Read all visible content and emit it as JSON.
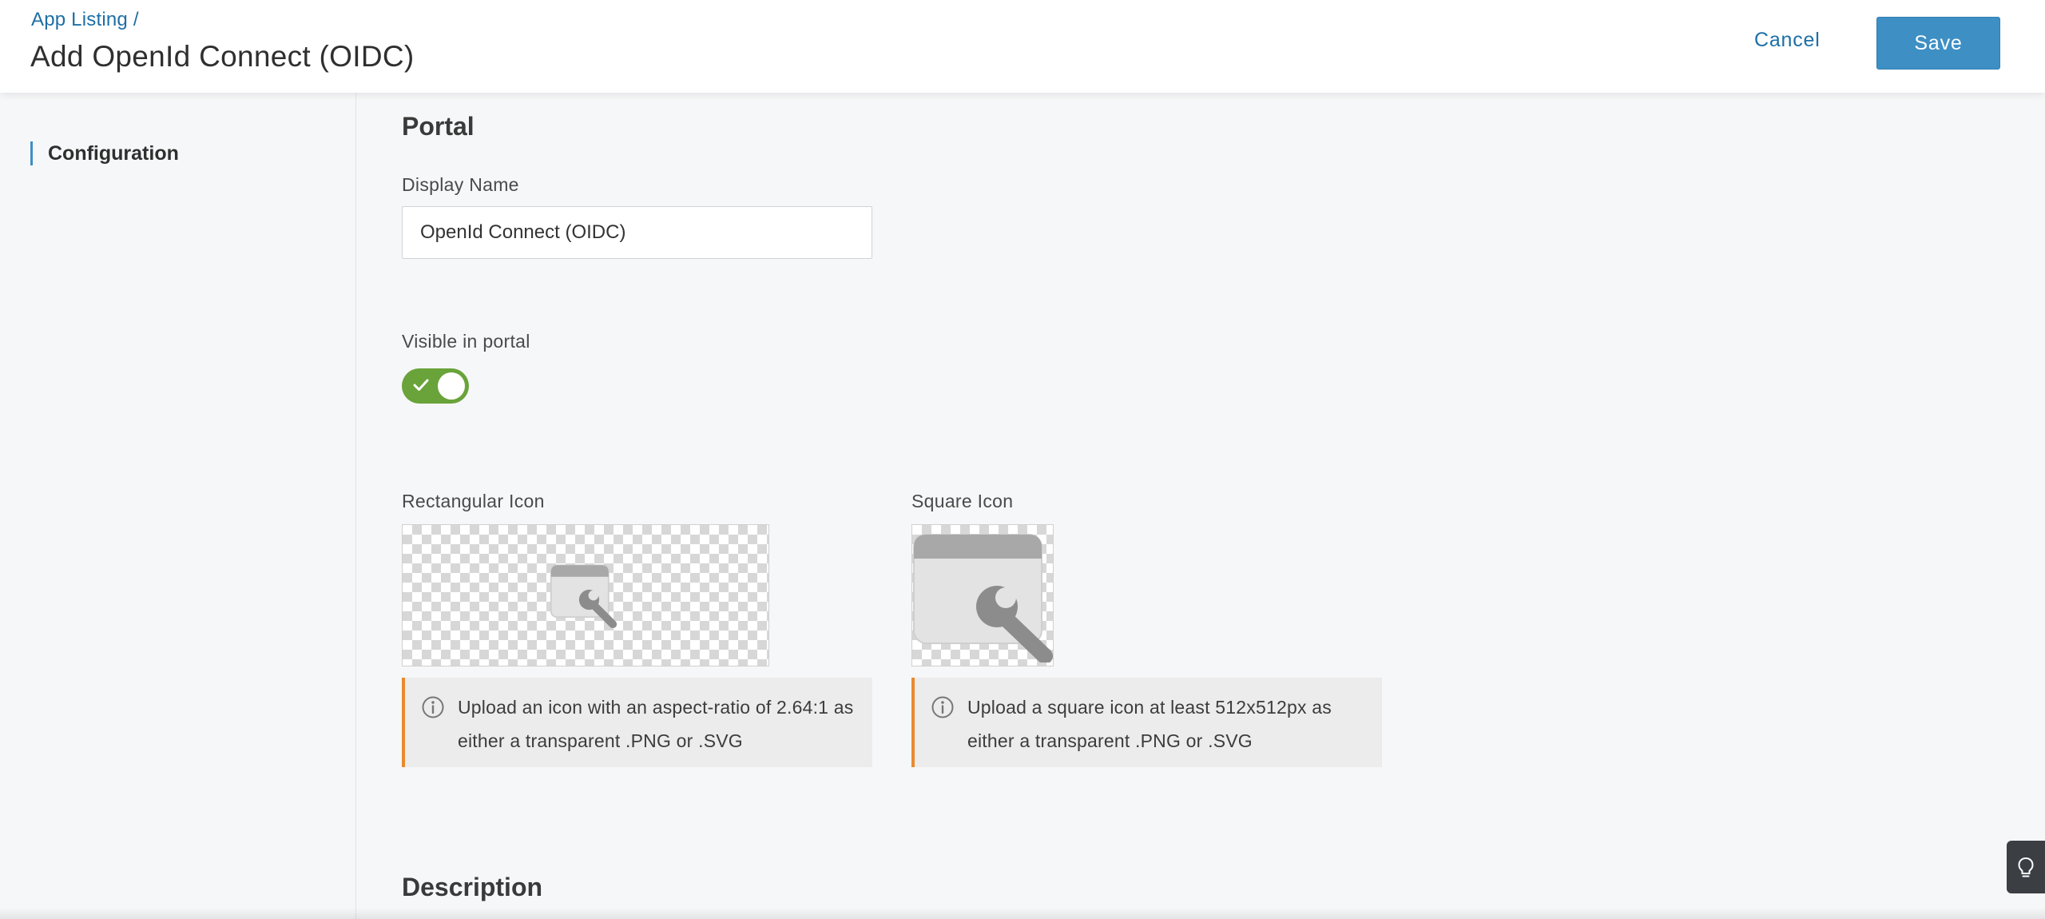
{
  "header": {
    "breadcrumb": "App Listing /",
    "title": "Add OpenId Connect (OIDC)",
    "cancel_label": "Cancel",
    "save_label": "Save"
  },
  "sidebar": {
    "items": [
      {
        "label": "Configuration",
        "active": true
      }
    ]
  },
  "portal": {
    "section_title": "Portal",
    "display_name_label": "Display Name",
    "display_name_value": "OpenId Connect (OIDC)",
    "visible_label": "Visible in portal",
    "visible": true,
    "rect_icon_label": "Rectangular Icon",
    "square_icon_label": "Square Icon",
    "rect_icon_hint": "Upload an icon with an aspect-ratio of 2.64:1 as either a transparent .PNG or .SVG",
    "square_icon_hint": "Upload a square icon at least 512x512px as either a transparent .PNG or .SVG"
  },
  "description": {
    "section_title": "Description"
  },
  "colors": {
    "accent": "#3d8fc4",
    "link": "#1d6fa5",
    "toggle_on": "#69a33a",
    "warning_bar": "#e98a2f"
  },
  "icons": {
    "toggle": "check-icon",
    "hint": "info-icon",
    "placeholder": "app-wrench-icon",
    "help": "lightbulb-icon"
  }
}
